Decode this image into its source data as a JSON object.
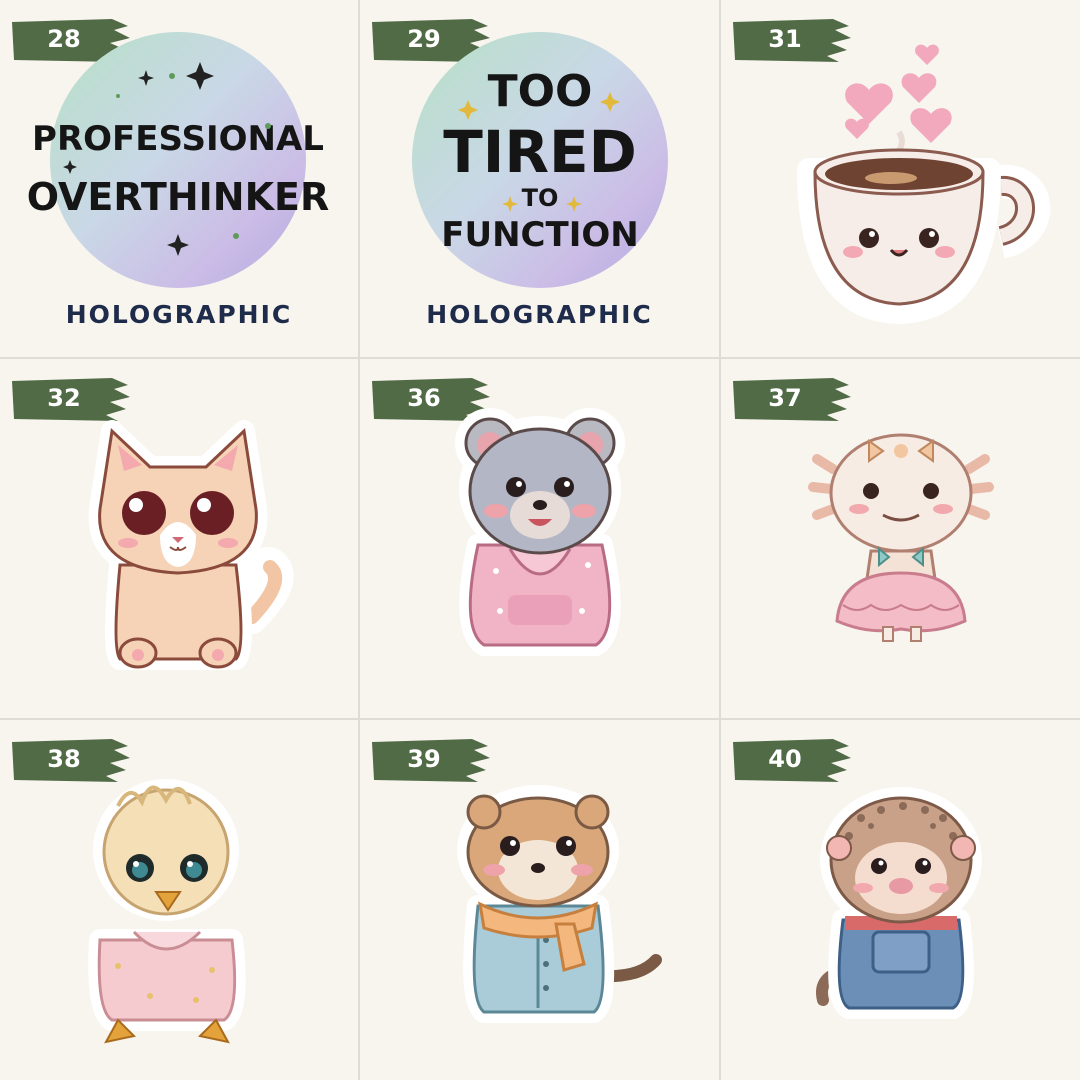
{
  "tiles": [
    {
      "number": "28",
      "kind": "text-sticker",
      "lines": [
        "PROFESSIONAL",
        "OVERTHINKER"
      ],
      "caption": "HOLOGRAPHIC"
    },
    {
      "number": "29",
      "kind": "text-sticker",
      "lines": [
        "TOO",
        "TIRED",
        "TO",
        "FUNCTION"
      ],
      "caption": "HOLOGRAPHIC"
    },
    {
      "number": "31",
      "kind": "illustration",
      "subject": "coffee-cup"
    },
    {
      "number": "32",
      "kind": "illustration",
      "subject": "cat"
    },
    {
      "number": "36",
      "kind": "illustration",
      "subject": "quokka-in-hoodie"
    },
    {
      "number": "37",
      "kind": "illustration",
      "subject": "axolotl-in-dress"
    },
    {
      "number": "38",
      "kind": "illustration",
      "subject": "chick-in-hoodie"
    },
    {
      "number": "39",
      "kind": "illustration",
      "subject": "ferret-in-scarf"
    },
    {
      "number": "40",
      "kind": "illustration",
      "subject": "hedgehog-in-overalls"
    }
  ],
  "colors": {
    "tag": "#526b47",
    "background": "#f8f5ee",
    "caption": "#1f2b4a"
  }
}
